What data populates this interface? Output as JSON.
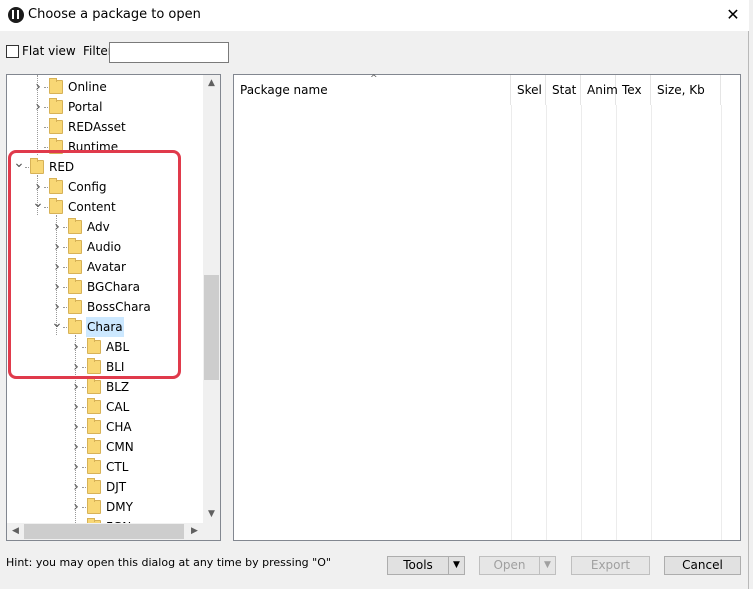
{
  "window": {
    "title": "Choose a package to open",
    "close_glyph": "✕"
  },
  "toolbar": {
    "flat_view_label": "Flat view",
    "filter_label": "Filter:",
    "filter_value": ""
  },
  "tree": {
    "nodes": [
      {
        "label": "Online",
        "expander": "collapsed"
      },
      {
        "label": "Portal",
        "expander": "collapsed"
      },
      {
        "label": "REDAsset",
        "expander": "none"
      },
      {
        "label": "Runtime",
        "expander": "none"
      },
      {
        "label": "RED",
        "expander": "expanded"
      },
      {
        "label": "Config",
        "expander": "collapsed"
      },
      {
        "label": "Content",
        "expander": "expanded"
      },
      {
        "label": "Adv",
        "expander": "collapsed"
      },
      {
        "label": "Audio",
        "expander": "collapsed"
      },
      {
        "label": "Avatar",
        "expander": "collapsed"
      },
      {
        "label": "BGChara",
        "expander": "collapsed"
      },
      {
        "label": "BossChara",
        "expander": "collapsed"
      },
      {
        "label": "Chara",
        "expander": "expanded",
        "selected": true
      },
      {
        "label": "ABL",
        "expander": "collapsed"
      },
      {
        "label": "BLI",
        "expander": "collapsed"
      },
      {
        "label": "BLZ",
        "expander": "collapsed"
      },
      {
        "label": "CAL",
        "expander": "collapsed"
      },
      {
        "label": "CHA",
        "expander": "collapsed"
      },
      {
        "label": "CMN",
        "expander": "collapsed"
      },
      {
        "label": "CTL",
        "expander": "collapsed"
      },
      {
        "label": "DJT",
        "expander": "collapsed"
      },
      {
        "label": "DMY",
        "expander": "collapsed"
      },
      {
        "label": "FGN",
        "expander": "collapsed"
      }
    ]
  },
  "list": {
    "columns": [
      "Package name",
      "Skel",
      "Stat",
      "Anim",
      "Tex",
      "Size, Kb"
    ],
    "sort_indicator": "^"
  },
  "footer": {
    "hint": "Hint: you may open this dialog at any time by pressing \"O\"",
    "tools_label": "Tools",
    "open_label": "Open",
    "export_label": "Export",
    "cancel_label": "Cancel"
  },
  "colors": {
    "highlight": "#e03a4b",
    "selection": "#cce8ff",
    "folder": "#f8d775"
  }
}
